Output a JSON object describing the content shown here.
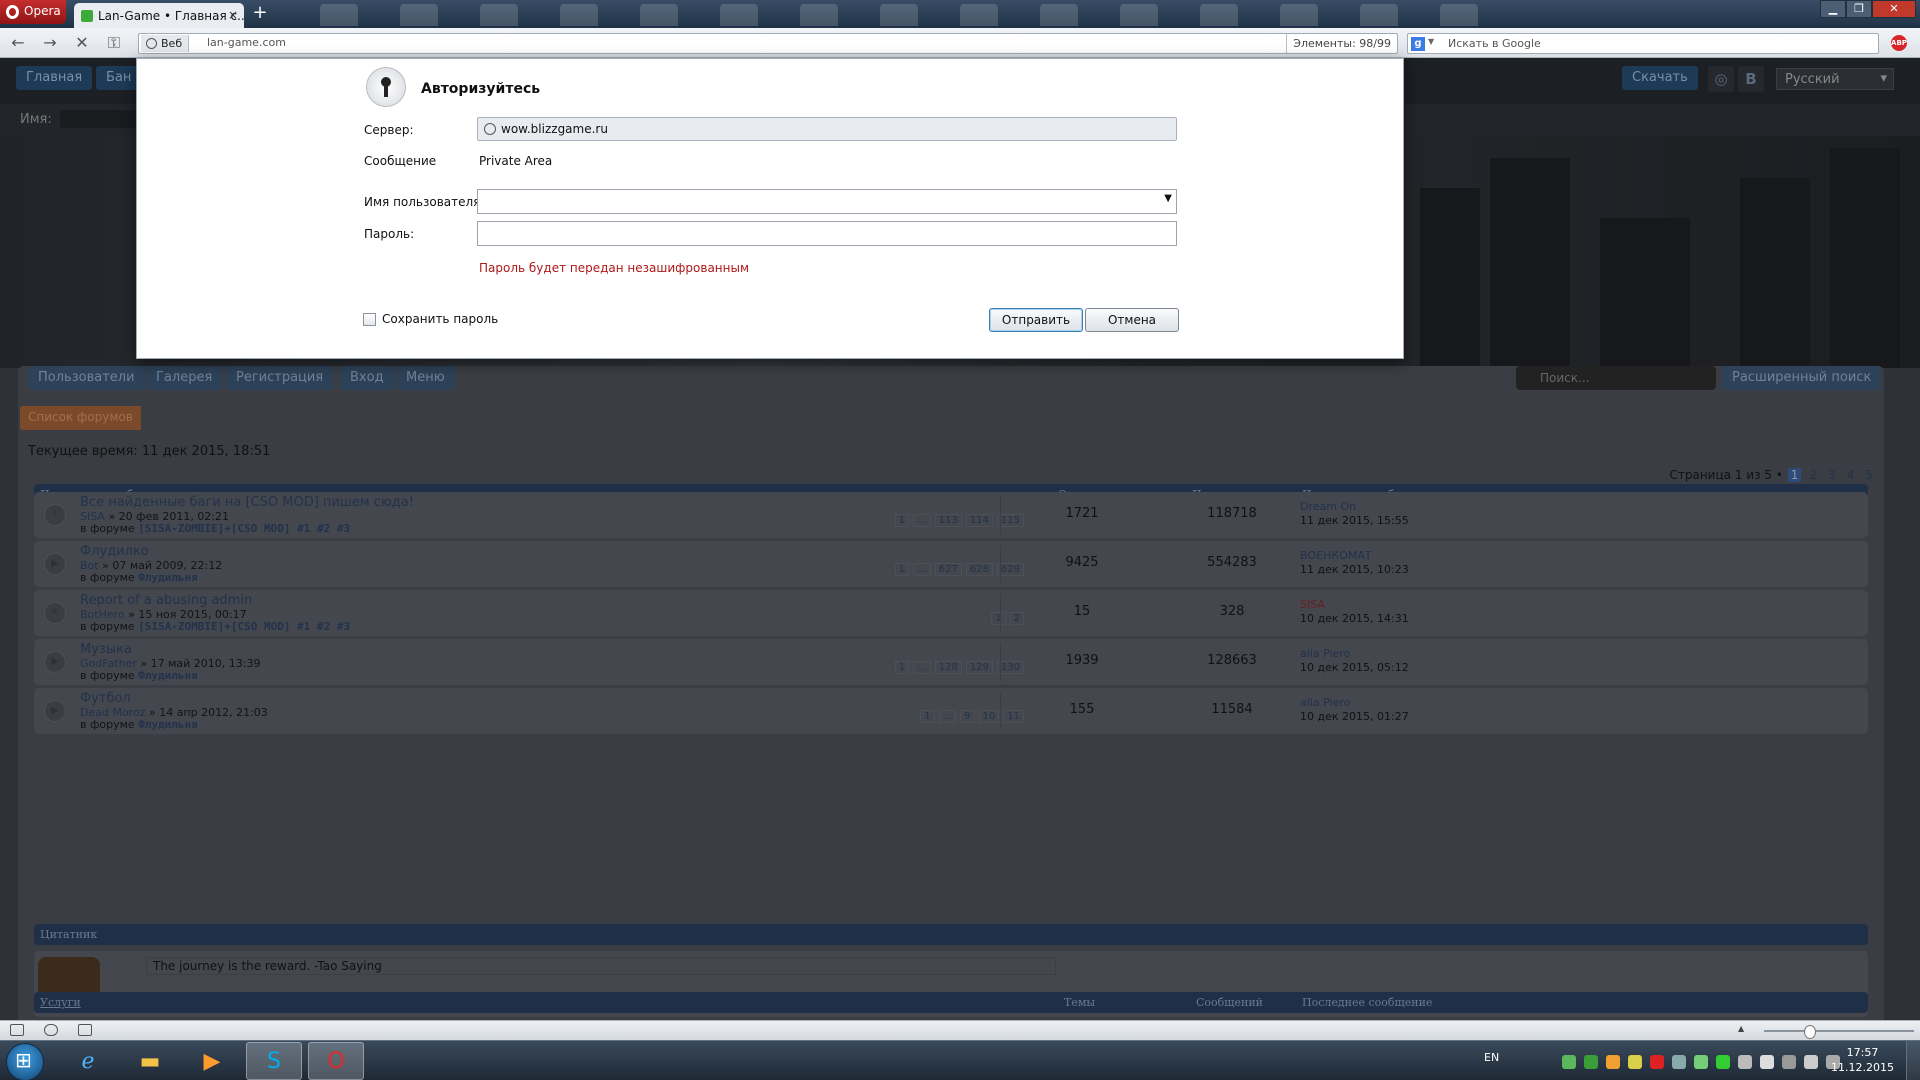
{
  "browser": {
    "menu_label": "Opera",
    "active_tab_title": "Lan-Game • Главная с...",
    "tab_close": "×",
    "new_tab": "+",
    "address_mode": "Веб",
    "url": "lan-game.com",
    "elements_counter": "Элементы:  98/99",
    "search_placeholder": "Искать в Google",
    "adblock_label": "ABP"
  },
  "dialog": {
    "title": "Авторизуйтесь",
    "server_label": "Сервер:",
    "server_value": "wow.blizzgame.ru",
    "message_label": "Сообщение",
    "message_value": "Private Area",
    "username_label": "Имя пользователя:",
    "username_value": "",
    "password_label": "Пароль:",
    "password_value": "",
    "warning": "Пароль будет передан незашифрованным",
    "save_password_label": "Сохранить пароль",
    "submit_label": "Отправить",
    "cancel_label": "Отмена"
  },
  "site": {
    "top_buttons": [
      "Главная",
      "Бан"
    ],
    "download_label": "Скачать",
    "language": "Русский",
    "name_label": "Имя:",
    "social_vk": "В",
    "tabs": [
      "Пользователи",
      "Галерея",
      "Регистрация",
      "Вход",
      "Меню"
    ],
    "search_placeholder": "Поиск...",
    "advanced_search": "Расширенный поиск",
    "breadcrumb": "Список форумов",
    "current_time": "Текущее время: 11 дек 2015, 18:51",
    "pagination": {
      "text": "Страница 1 из 5 •",
      "pages": [
        "1",
        "2",
        "3",
        "4",
        "5"
      ],
      "current": "1"
    },
    "latest_header": {
      "title": "Последние сообщения",
      "replies": "Ответов",
      "views": "Просмотров",
      "last": "Последнее сообщение"
    },
    "topics": [
      {
        "title": "Все найденные баги на [CSO MOD] пишем сюда!",
        "author": "SISA",
        "date": "» 20 фев 2011, 02:21",
        "forum_prefix": "в форуме",
        "forum": "[SISA-ZOMBIE]+[CSO MOD] #1 #2 #3",
        "pages": [
          "1",
          "...",
          "113",
          "114",
          "115"
        ],
        "replies": "1721",
        "views": "118718",
        "last_user": "Dream On",
        "last_date": "11 дек 2015, 15:55",
        "icon": "!"
      },
      {
        "title": "Флудилко",
        "author": "Bot",
        "date": "» 07 май 2009, 22:12",
        "forum_prefix": "в форуме",
        "forum": "Флудильня",
        "pages": [
          "1",
          "...",
          "627",
          "628",
          "629"
        ],
        "replies": "9425",
        "views": "554283",
        "last_user": "ВОЕНКОМАТ",
        "last_date": "11 дек 2015, 10:23",
        "icon": "▶"
      },
      {
        "title": "Report of a abusing admin",
        "author": "BotHero",
        "date": "» 15 ноя 2015, 00:17",
        "forum_prefix": "в форуме",
        "forum": "[SISA-ZOMBIE]+[CSO MOD] #1 #2 #3",
        "pages": [
          "1",
          "2"
        ],
        "replies": "15",
        "views": "328",
        "last_user": "SISA",
        "last_date": "10 дек 2015, 14:31",
        "icon": "✕"
      },
      {
        "title": "Музыка",
        "author": "GodFather",
        "date": "» 17 май 2010, 13:39",
        "forum_prefix": "в форуме",
        "forum": "Флудильня",
        "pages": [
          "1",
          "...",
          "128",
          "129",
          "130"
        ],
        "replies": "1939",
        "views": "128663",
        "last_user": "alia Piero",
        "last_date": "10 дек 2015, 05:12",
        "icon": "▶"
      },
      {
        "title": "Футбол",
        "author": "Dead Moroz",
        "date": "» 14 апр 2012, 21:03",
        "forum_prefix": "в форуме",
        "forum": "Флудильня",
        "pages": [
          "1",
          "...",
          "9",
          "10",
          "11"
        ],
        "replies": "155",
        "views": "11584",
        "last_user": "alia Piero",
        "last_date": "10 дек 2015, 01:27",
        "icon": "▶"
      }
    ],
    "quote_header": "Цитатник",
    "quote": "The journey is the reward. -Tao Saying",
    "services_header": {
      "title": "Услуги",
      "topics": "Темы",
      "posts": "Сообщений",
      "last": "Последнее сообщение"
    }
  },
  "taskbar": {
    "language": "EN",
    "time": "17:57",
    "date": "11.12.2015"
  }
}
